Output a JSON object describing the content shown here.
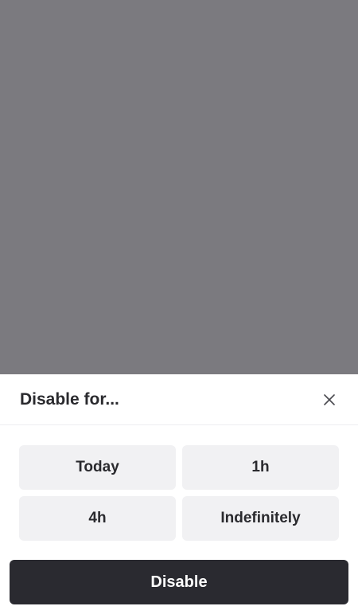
{
  "sheet": {
    "title": "Disable for...",
    "options": [
      {
        "label": "Today"
      },
      {
        "label": "1h"
      },
      {
        "label": "4h"
      },
      {
        "label": "Indefinitely"
      }
    ],
    "primary_label": "Disable"
  },
  "colors": {
    "backdrop": "#7b7a7f",
    "option_bg": "#f1f1f3",
    "primary_bg": "#2a2a30",
    "text": "#2a2a2e"
  },
  "icons": {
    "close": "close-icon"
  }
}
